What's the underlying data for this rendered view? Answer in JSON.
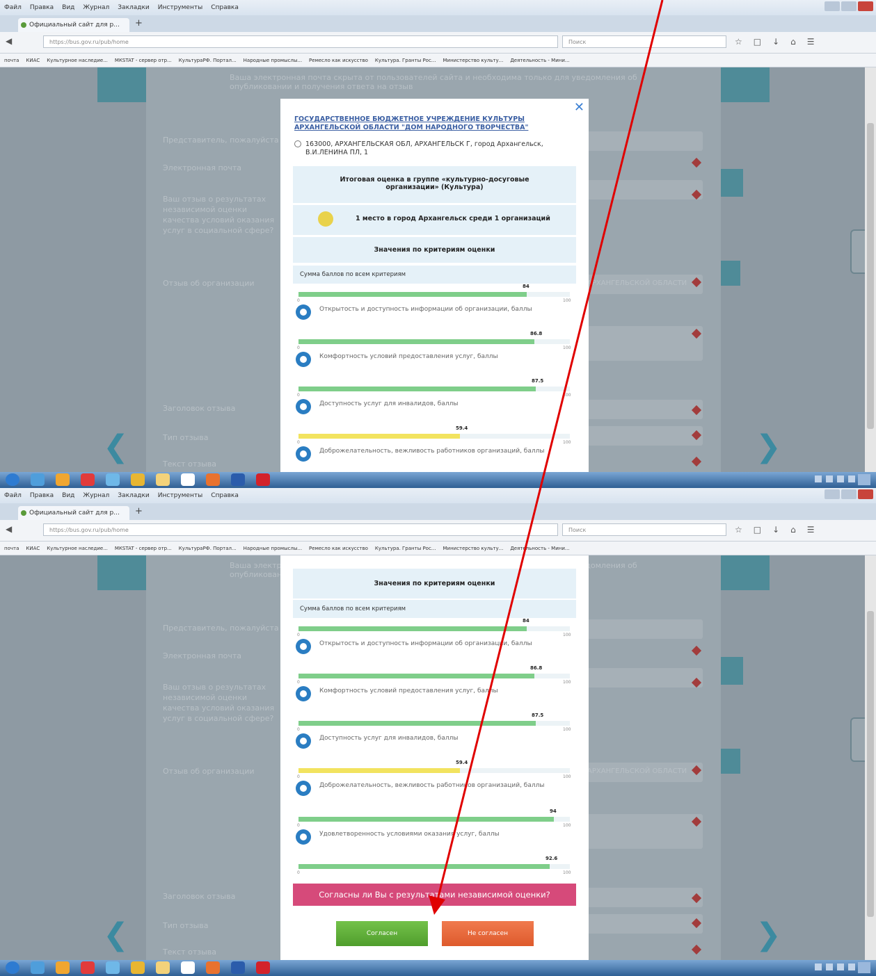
{
  "browser": {
    "menu": [
      "Файл",
      "Правка",
      "Вид",
      "Журнал",
      "Закладки",
      "Инструменты",
      "Справка"
    ],
    "tab_title": "Официальный сайт для р...",
    "url": "https://bus.gov.ru/pub/home",
    "search_placeholder": "Поиск",
    "bookmarks": [
      "почта",
      "КИАС",
      "Культурное наследие...",
      "МКSTAT - сервер отр...",
      "КультураРФ. Портал...",
      "Народные промыслы...",
      "Ремесло как искусство",
      "Культура. Гранты Рос...",
      "Министерство культу...",
      "Деятельность - Мини..."
    ]
  },
  "modal": {
    "org_name": "ГОСУДАРСТВЕННОЕ БЮДЖЕТНОЕ УЧРЕЖДЕНИЕ КУЛЬТУРЫ АРХАНГЕЛЬСКОЙ ОБЛАСТИ \"ДОМ НАРОДНОГО ТВОРЧЕСТВА\"",
    "address": "163000, АРХАНГЕЛЬСКАЯ ОБЛ, АРХАНГЕЛЬСК Г, город Архангельск, В.И.ЛЕНИНА ПЛ, 1",
    "group_title": "Итоговая оценка в группе «культурно-досуговые организации» (Культура)",
    "rank": "1 место в город Архангельск среди 1 организаций",
    "criteria_title": "Значения по критериям оценки",
    "sum_label": "Сумма баллов по всем критериям",
    "scale_min": "0",
    "scale_max": "100",
    "agree_question": "Согласны ли Вы с результатами независимой оценки?",
    "agree_button": "Согласен",
    "disagree_button": "Не согласен",
    "criteria": [
      {
        "value": 84,
        "value_label": "84",
        "label": "Открытость и доступность информации об организации, баллы",
        "color": "#7fce8a"
      },
      {
        "value": 86.8,
        "value_label": "86.8",
        "label": "Комфортность условий предоставления услуг, баллы",
        "color": "#7fce8a"
      },
      {
        "value": 87.5,
        "value_label": "87.5",
        "label": "Доступность услуг для инвалидов, баллы",
        "color": "#7fce8a"
      },
      {
        "value": 59.4,
        "value_label": "59.4",
        "label": "Доброжелательность, вежливость работников организаций, баллы",
        "color": "#f2e35f"
      },
      {
        "value": 94,
        "value_label": "94",
        "label": "Удовлетворенность условиями оказания услуг, баллы",
        "color": "#7fce8a"
      },
      {
        "value": 92.6,
        "value_label": "92.6",
        "label": "",
        "color": "#7fce8a"
      }
    ]
  },
  "background_form": {
    "intro_text": "Ваша электронная почта скрыта от пользователей сайта и необходима только для уведомления об опубликовании и получения ответа на отзыв",
    "fields": [
      "Представитель, пожалуйста",
      "Электронная почта",
      "Ваш отзыв о результатах независимой оценки качества условий оказания услуг в социальной сфере?",
      "Отзыв об организации",
      "Заголовок отзыва",
      "Тип отзыва",
      "Текст отзыва"
    ],
    "org_field_value": "АРХАНГЕЛЬСКОЙ ОБЛАСТИ"
  },
  "colors": {
    "accent_teal": "#4f8b98",
    "agree_bar": "#d64a7a",
    "agree_button": "#5fb23a",
    "disagree_button": "#e9683b",
    "annotation_arrow": "#e00000"
  }
}
